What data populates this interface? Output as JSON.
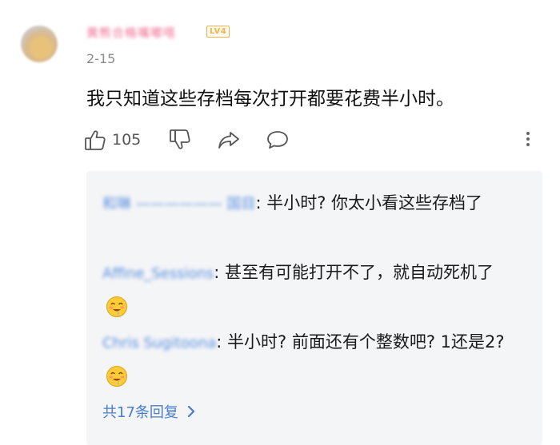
{
  "comment": {
    "username": "黄熊合格嘴嘟嗒",
    "level_badge": "LV4",
    "date": "2-15",
    "text": "我只知道这些存档每次打开都要花费半小时。",
    "likes": "105"
  },
  "icons": {
    "like": "thumbs-up-icon",
    "dislike": "thumbs-down-icon",
    "share": "share-icon",
    "comment": "comment-icon",
    "more": "more-vertical-icon",
    "emoji": "drooling-face-emoji"
  },
  "replies": [
    {
      "author": "和琳 —————— 国目",
      "text": "半小时? 你太小看这些存档了",
      "emoji": false
    },
    {
      "author": "Affine_Sessions",
      "text": "甚至有可能打开不了，就自动死机了",
      "emoji": true
    },
    {
      "author": "Chris Sugitoona",
      "text": "半小时? 前面还有个整数吧? 1还是2?",
      "emoji": true
    }
  ],
  "more_replies_label": "共17条回复",
  "colors": {
    "link": "#4a7ccc",
    "badge": "#f4b24a",
    "reply_bg": "#f4f5f7"
  }
}
